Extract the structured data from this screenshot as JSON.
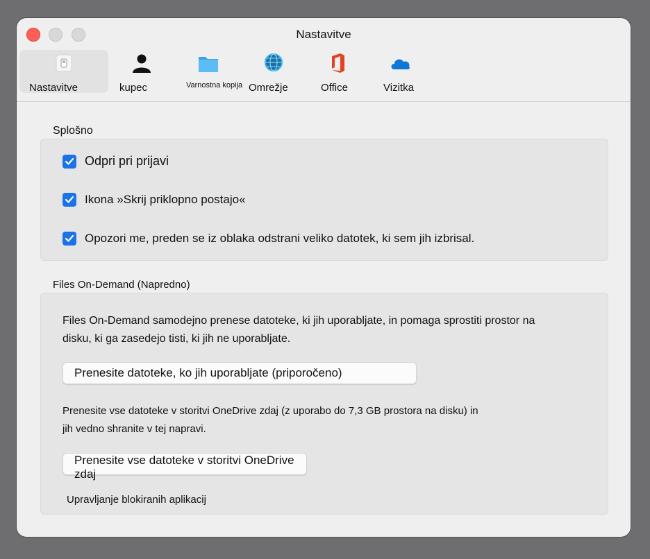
{
  "window": {
    "title": "Nastavitve",
    "traffic_lights": {
      "close": "#ff5f57",
      "minimize": "#d8d8d8",
      "maximize": "#d8d8d8"
    }
  },
  "toolbar": {
    "tabs": [
      {
        "label": "Nastavitve",
        "icon": "switch-icon",
        "active": true
      },
      {
        "label": "kupec",
        "icon": "person-icon",
        "active": false
      },
      {
        "label": "Varnostna kopija",
        "icon": "folder-icon",
        "active": false
      },
      {
        "label": "Omrežje",
        "icon": "globe-icon",
        "active": false
      },
      {
        "label": "Office",
        "icon": "office-icon",
        "active": false
      },
      {
        "label": "Vizitka",
        "icon": "cloud-icon",
        "active": false
      }
    ]
  },
  "general": {
    "title": "Splošno",
    "options": [
      {
        "label": "Odpri pri prijavi",
        "checked": true
      },
      {
        "label": "Ikona »Skrij priklopno postajo«",
        "checked": true
      },
      {
        "label": "Opozori me, preden se iz oblaka odstrani veliko datotek, ki sem jih izbrisal.",
        "checked": true
      }
    ]
  },
  "files_on_demand": {
    "title": "Files On-Demand (Napredno)",
    "description_line1": "Files On-Demand samodejno prenese datoteke, ki jih uporabljate, in pomaga sprostiti prostor na",
    "description_line2": "disku, ki ga zasedejo tisti, ki jih ne uporabljate.",
    "button_recommended": "Prenesite datoteke, ko jih uporabljate (priporočeno)",
    "all_files_line1": "Prenesite vse datoteke v storitvi OneDrive zdaj (z uporabo do 7,3 GB prostora na disku) in",
    "all_files_line2": "jih vedno shranite v tej napravi.",
    "button_all": "Prenesite vse datoteke v storitvi OneDrive zdaj",
    "manage_link": "Upravljanje blokiranih aplikacij"
  },
  "colors": {
    "accent": "#1a73e8",
    "window_bg": "#efefef",
    "group_bg": "#e5e5e5"
  }
}
